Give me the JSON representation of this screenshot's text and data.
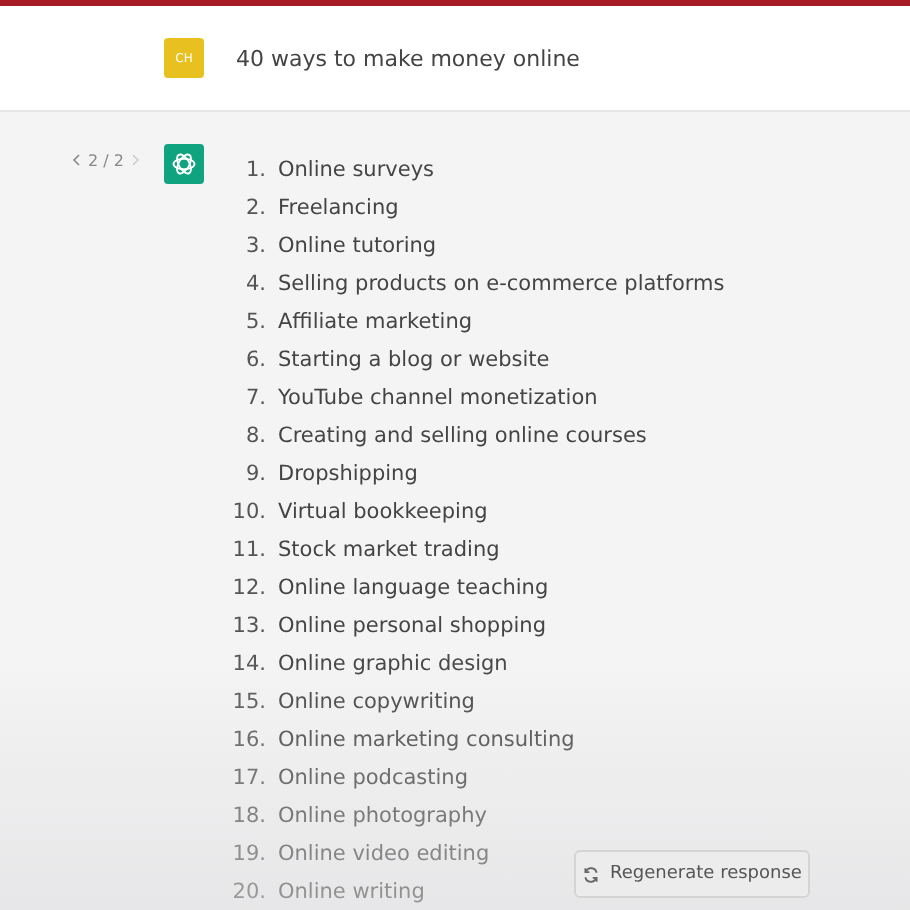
{
  "prompt": {
    "avatar": "CH",
    "text": "40 ways to make money online"
  },
  "response": {
    "pager": "2 / 2",
    "items": [
      {
        "number": "1.",
        "text": "Online surveys"
      },
      {
        "number": "2.",
        "text": "Freelancing"
      },
      {
        "number": "3.",
        "text": "Online tutoring"
      },
      {
        "number": "4.",
        "text": "Selling products on e-commerce platforms"
      },
      {
        "number": "5.",
        "text": "Affiliate marketing"
      },
      {
        "number": "6.",
        "text": "Starting a blog or website"
      },
      {
        "number": "7.",
        "text": "YouTube channel monetization"
      },
      {
        "number": "8.",
        "text": "Creating and selling online courses"
      },
      {
        "number": "9.",
        "text": "Dropshipping"
      },
      {
        "number": "10.",
        "text": "Virtual bookkeeping"
      },
      {
        "number": "11.",
        "text": "Stock market trading"
      },
      {
        "number": "12.",
        "text": "Online language teaching"
      },
      {
        "number": "13.",
        "text": "Online personal shopping"
      },
      {
        "number": "14.",
        "text": "Online graphic design"
      },
      {
        "number": "15.",
        "text": "Online copywriting"
      },
      {
        "number": "16.",
        "text": "Online marketing consulting"
      },
      {
        "number": "17.",
        "text": "Online podcasting"
      },
      {
        "number": "18.",
        "text": "Online photography"
      },
      {
        "number": "19.",
        "text": "Online video editing"
      },
      {
        "number": "20.",
        "text": "Online writing"
      }
    ]
  },
  "regenerate_button": "Regenerate response"
}
